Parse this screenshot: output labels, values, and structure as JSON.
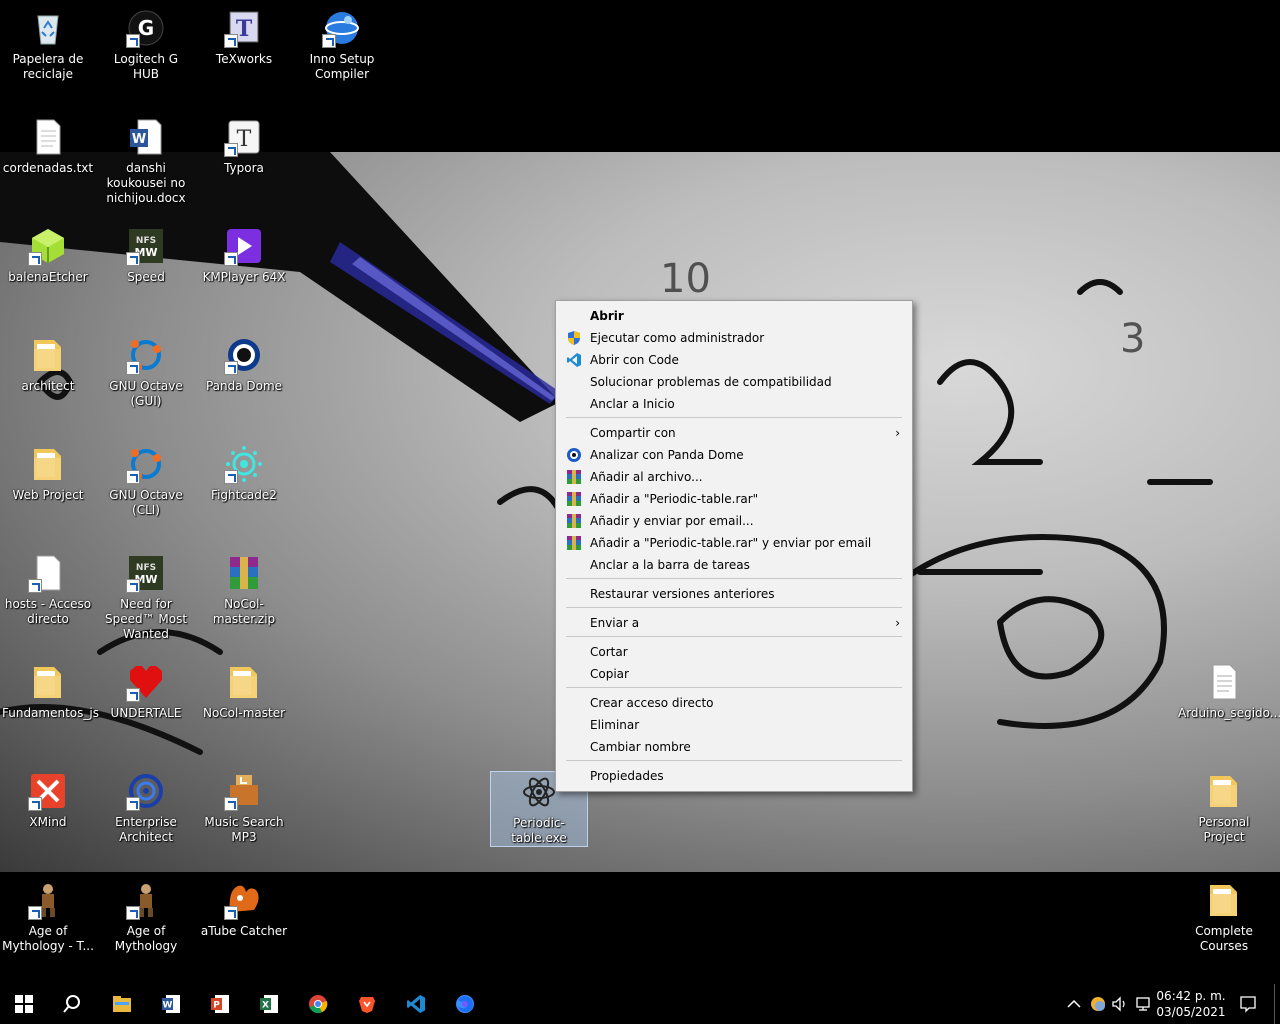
{
  "desktop": {
    "icons": [
      {
        "label": "Papelera de reciclaje",
        "icon": "recycle-bin-icon"
      },
      {
        "label": "Logitech G HUB",
        "icon": "logitech-icon"
      },
      {
        "label": "TeXworks",
        "icon": "texworks-icon"
      },
      {
        "label": "Inno Setup Compiler",
        "icon": "inno-setup-icon"
      },
      {
        "label": "cordenadas.txt",
        "icon": "text-file-icon"
      },
      {
        "label": "danshi koukousei no nichijou.docx",
        "icon": "word-document-icon"
      },
      {
        "label": "Typora",
        "icon": "typora-icon"
      },
      {
        "label": "balenaEtcher",
        "icon": "balena-etcher-icon"
      },
      {
        "label": "Speed",
        "icon": "nfs-speed-icon"
      },
      {
        "label": "KMPlayer 64X",
        "icon": "kmplayer-icon"
      },
      {
        "label": "architect",
        "icon": "folder-icon"
      },
      {
        "label": "GNU Octave (GUI)",
        "icon": "octave-icon"
      },
      {
        "label": "Panda Dome",
        "icon": "panda-dome-icon"
      },
      {
        "label": "Web Project",
        "icon": "folder-icon"
      },
      {
        "label": "GNU Octave (CLI)",
        "icon": "octave-icon"
      },
      {
        "label": "Fightcade2",
        "icon": "fightcade-icon"
      },
      {
        "label": "hosts - Acceso directo",
        "icon": "file-icon"
      },
      {
        "label": "Need for Speed™ Most Wanted",
        "icon": "nfs-icon"
      },
      {
        "label": "NoCol-master.zip",
        "icon": "winrar-archive-icon"
      },
      {
        "label": "Fundamentos_js",
        "icon": "folder-icon"
      },
      {
        "label": "UNDERTALE",
        "icon": "undertale-heart-icon"
      },
      {
        "label": "NoCol-master",
        "icon": "folder-icon"
      },
      {
        "label": "XMind",
        "icon": "xmind-icon"
      },
      {
        "label": "Enterprise Architect",
        "icon": "enterprise-architect-icon"
      },
      {
        "label": "Music Search MP3",
        "icon": "music-search-icon"
      },
      {
        "label": "Age of Mythology - T...",
        "icon": "aom-titans-icon"
      },
      {
        "label": "Age of Mythology",
        "icon": "aom-icon"
      },
      {
        "label": "aTube Catcher",
        "icon": "atube-catcher-icon"
      },
      {
        "label": "Periodic-table.exe",
        "icon": "atom-exe-icon"
      },
      {
        "label": "Arduino_segido...",
        "icon": "document-file-icon"
      },
      {
        "label": "Personal Project",
        "icon": "folder-icon"
      },
      {
        "label": "Complete Courses",
        "icon": "folder-icon"
      }
    ]
  },
  "context_menu": {
    "items": [
      {
        "label": "Abrir",
        "bold": true
      },
      {
        "label": "Ejecutar como administrador",
        "icon": "uac-shield-icon"
      },
      {
        "label": "Abrir con Code",
        "icon": "vscode-icon"
      },
      {
        "label": "Solucionar problemas de compatibilidad"
      },
      {
        "label": "Anclar a Inicio"
      },
      {
        "label": "Compartir con",
        "submenu": true
      },
      {
        "label": "Analizar con Panda Dome",
        "icon": "panda-dome-icon"
      },
      {
        "label": "Añadir al archivo...",
        "icon": "winrar-icon"
      },
      {
        "label": "Añadir a \"Periodic-table.rar\"",
        "icon": "winrar-icon"
      },
      {
        "label": "Añadir y enviar por email...",
        "icon": "winrar-icon"
      },
      {
        "label": "Añadir a \"Periodic-table.rar\" y enviar por email",
        "icon": "winrar-icon"
      },
      {
        "label": "Anclar a la barra de tareas"
      },
      {
        "label": "Restaurar versiones anteriores"
      },
      {
        "label": "Enviar a",
        "submenu": true
      },
      {
        "label": "Cortar"
      },
      {
        "label": "Copiar"
      },
      {
        "label": "Crear acceso directo"
      },
      {
        "label": "Eliminar"
      },
      {
        "label": "Cambiar nombre"
      },
      {
        "label": "Propiedades"
      }
    ],
    "submenu_arrow": "›"
  },
  "taskbar": {
    "apps": [
      "start-icon",
      "search-icon",
      "file-explorer-icon",
      "word-icon",
      "powerpoint-icon",
      "excel-icon",
      "chrome-icon",
      "brave-icon",
      "vscode-icon",
      "firefox-icon"
    ],
    "tray": [
      "show-hidden-icons-chevron",
      "weather-icon",
      "volume-icon",
      "network-icon"
    ],
    "time": "06:42 p. m.",
    "date": "03/05/2021"
  }
}
